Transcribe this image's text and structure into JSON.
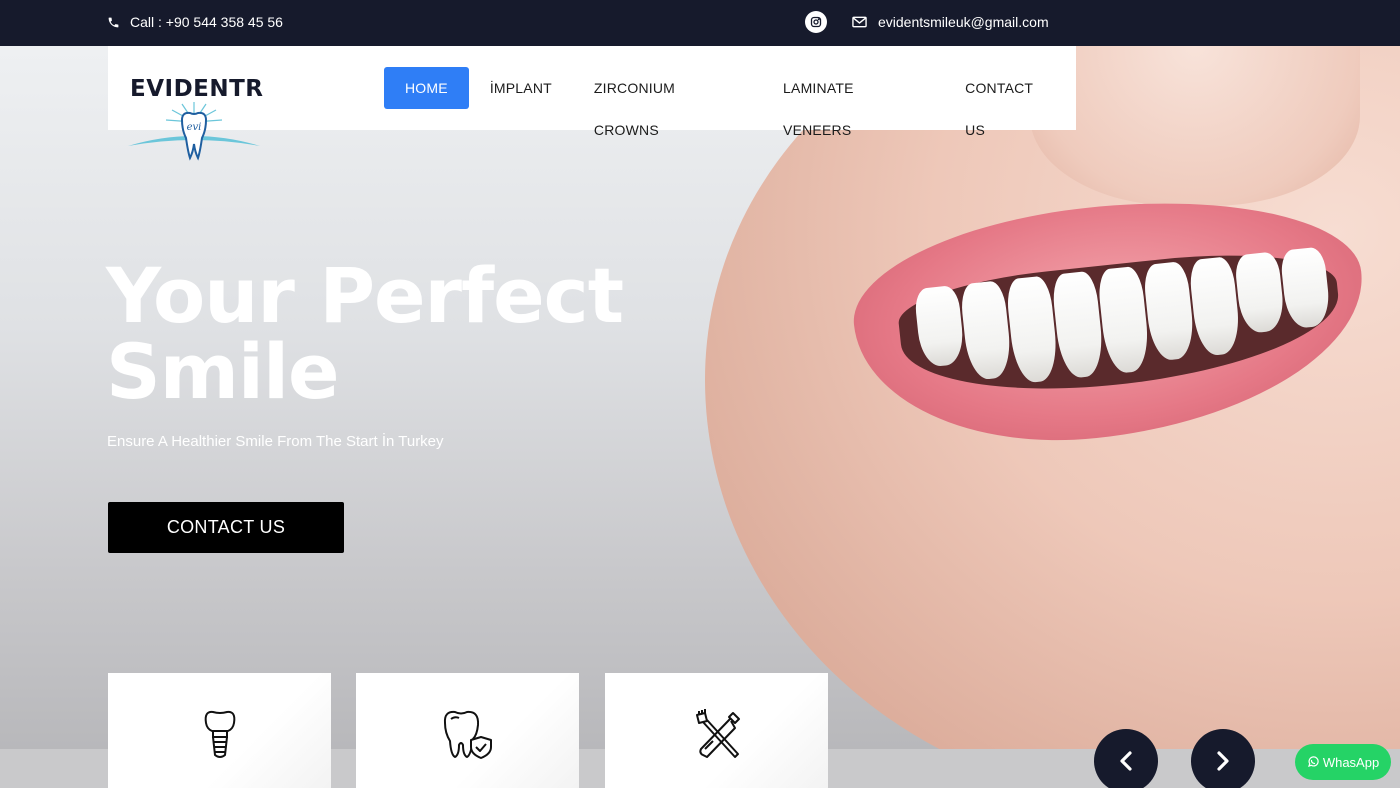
{
  "topbar": {
    "call_text": "Call : +90 544 358 45 56",
    "email": "evidentsmileuk@gmail.com",
    "icons": [
      "phone-icon",
      "instagram-icon",
      "mail-icon"
    ]
  },
  "brand": {
    "name": "EVIDENTR",
    "mark_text": "evi"
  },
  "nav": {
    "items": [
      {
        "label": "HOME",
        "active": true
      },
      {
        "label": "İMPLANT",
        "active": false
      },
      {
        "label": "ZIRCONIUM CROWNS",
        "active": false
      },
      {
        "label": "LAMINATE VENEERS",
        "active": false
      },
      {
        "label": "CONTACT US",
        "active": false
      }
    ]
  },
  "hero": {
    "title_line1": "Your Perfect",
    "title_line2": "Smile",
    "subtitle": "Ensure A Healthier Smile From The Start İn Turkey",
    "cta_label": "CONTACT US"
  },
  "services": {
    "icons": [
      "dental-implant-icon",
      "tooth-shield-icon",
      "toothbrush-toothpaste-icon"
    ]
  },
  "slider": {
    "prev_icon": "chevron-left-icon",
    "next_icon": "chevron-right-icon"
  },
  "whatsapp": {
    "label": "WhasApp"
  },
  "colors": {
    "topbar": "#161a2c",
    "accent": "#2f7ef6",
    "cta": "#000000",
    "whatsapp": "#25d366"
  }
}
